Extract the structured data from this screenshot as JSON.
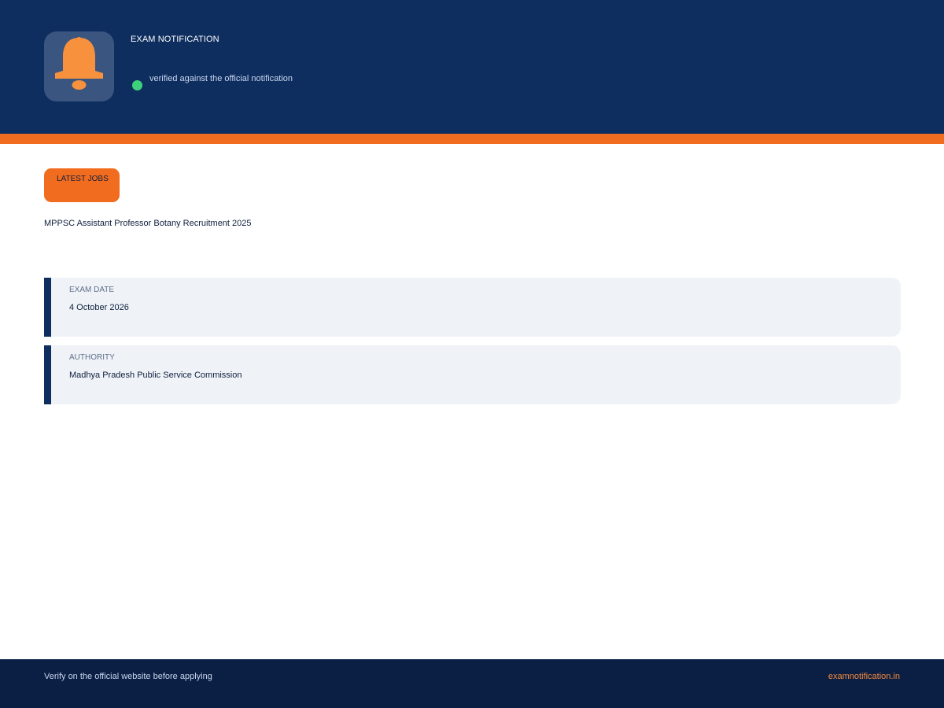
{
  "header": {
    "logo_icon": "bell-icon",
    "title": "EXAM NOTIFICATION",
    "verified_text": "verified against the official notification"
  },
  "category": {
    "label": "LATEST JOBS"
  },
  "job": {
    "title": "MPPSC Assistant Professor Botany Recruitment 2025"
  },
  "details": [
    {
      "label": "EXAM DATE",
      "value": "4 October 2026"
    },
    {
      "label": "AUTHORITY",
      "value": "Madhya Pradesh Public Service Commission"
    }
  ],
  "footer": {
    "note": "Verify on the official website before applying",
    "site": "examnotification.in"
  },
  "colors": {
    "header_bg": "#0f2e60",
    "accent": "#f26c1f",
    "verified": "#3ed37a",
    "footer_bg": "#0b1f45",
    "card_bg": "#eff3f8"
  }
}
